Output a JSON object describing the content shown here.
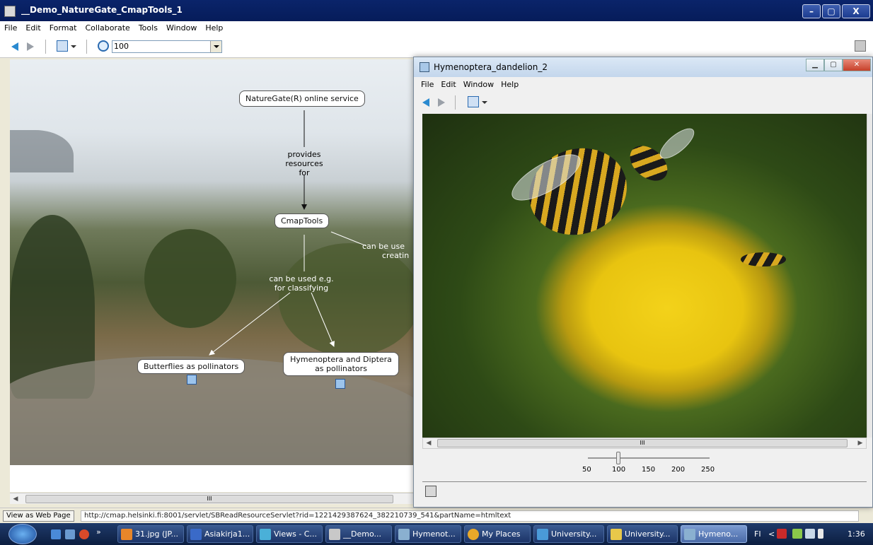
{
  "main_window": {
    "title": "__Demo_NatureGate_CmapTools_1",
    "controls": {
      "minimize": "–",
      "maximize": "▢",
      "close": "X"
    }
  },
  "menu": [
    "File",
    "Edit",
    "Format",
    "Collaborate",
    "Tools",
    "Window",
    "Help"
  ],
  "toolbar": {
    "zoom_value": "100"
  },
  "cmap": {
    "nodes": {
      "naturegate": "NatureGate(R) online service",
      "cmaptools": "CmapTools",
      "butterflies": "Butterflies as pollinators",
      "hymenoptera": "Hymenoptera and Diptera as pollinators"
    },
    "links": {
      "provides": [
        "provides",
        "resources",
        "for"
      ],
      "classifying": [
        "can be used e.g.",
        "for classifying"
      ],
      "creating": [
        "can be use",
        "creatin"
      ]
    }
  },
  "hscroll_grip": "III",
  "status": {
    "view_web_page": "View as Web Page",
    "url": "http://cmap.helsinki.fi:8001/servlet/SBReadResourceServlet?rid=1221429387624_382210739_541&partName=htmltext"
  },
  "popup": {
    "title": "Hymenoptera_dandelion_2",
    "menu": [
      "File",
      "Edit",
      "Window",
      "Help"
    ],
    "scroll_grip": "III",
    "zoom_ticks": [
      "50",
      "100",
      "150",
      "200",
      "250"
    ],
    "zoom_level_percent": 100
  },
  "taskbar": {
    "more_label": "»",
    "items": [
      "31.jpg (JP...",
      "Asiakirja1...",
      "Views - C...",
      "__Demo...",
      "Hymenot...",
      "My Places",
      "University...",
      "University...",
      "Hymeno..."
    ],
    "language": "FI",
    "time": "1:36"
  },
  "colors": {
    "title_bar": "#0a246a",
    "taskbar": "#1f3a6a",
    "dandelion": "#f3d21a",
    "accent_blue": "#2a8ad0"
  }
}
